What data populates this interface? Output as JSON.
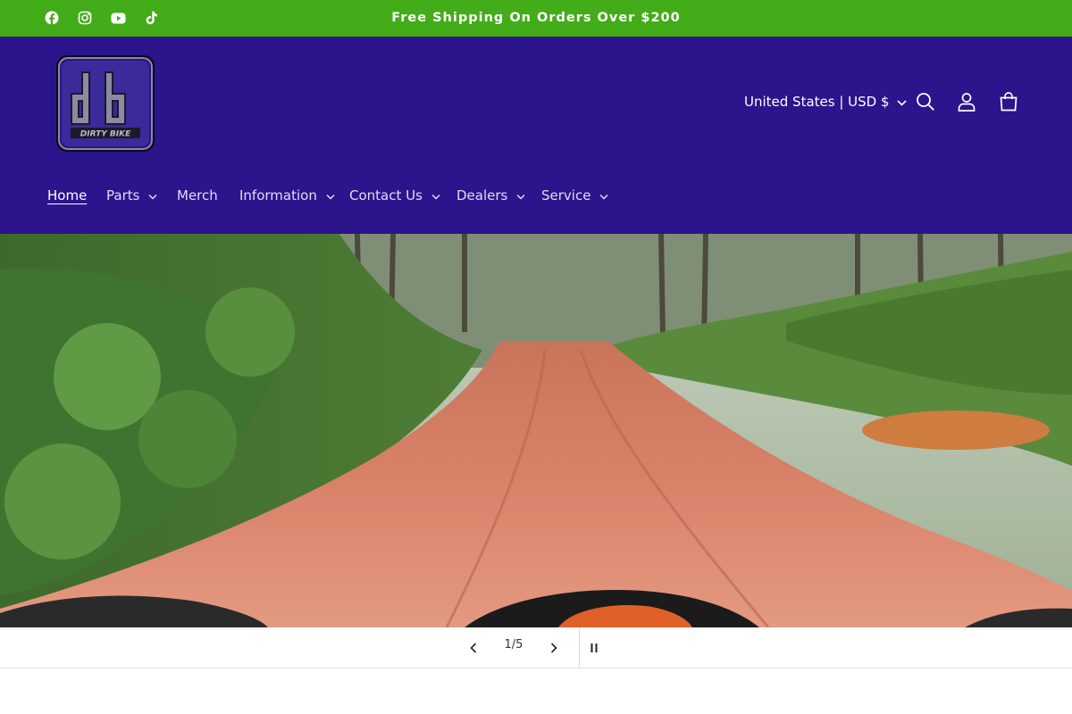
{
  "announcement": {
    "text": "Free Shipping On Orders Over $200",
    "background": "#43ac19"
  },
  "social": [
    "facebook-icon",
    "instagram-icon",
    "youtube-icon",
    "tiktok-icon"
  ],
  "header": {
    "background": "#2c148c",
    "logo": {
      "monogram": "db",
      "wordmark": "DIRTY BIKE"
    },
    "country_selector": "United States | USD $",
    "icons": [
      "search-icon",
      "account-icon",
      "cart-icon"
    ]
  },
  "nav": {
    "items": [
      {
        "label": "Home",
        "active": true,
        "dropdown": false
      },
      {
        "label": "Parts",
        "dropdown": true
      },
      {
        "label": "Merch",
        "dropdown": false
      },
      {
        "label": "Information",
        "dropdown": true
      },
      {
        "label": "Contact Us",
        "dropdown": true
      },
      {
        "label": "Dealers",
        "dropdown": true
      },
      {
        "label": "Service",
        "dropdown": true
      }
    ]
  },
  "slideshow": {
    "current": 1,
    "total": 5,
    "counter": "1/5",
    "hero_description": "dirt-road-forest-pov"
  }
}
